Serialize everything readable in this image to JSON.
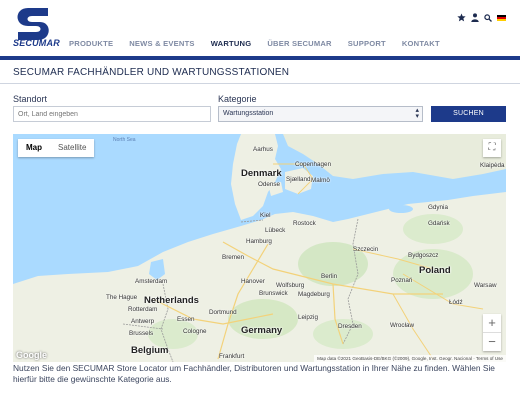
{
  "header": {
    "logo_text": "SECUMAR",
    "nav": [
      "PRODUKTE",
      "NEWS & EVENTS",
      "WARTUNG",
      "ÜBER SECUMAR",
      "SUPPORT",
      "KONTAKT"
    ],
    "active_nav": "WARTUNG",
    "utility_icons": [
      "star-icon",
      "user-icon",
      "search-icon",
      "german-flag-icon"
    ]
  },
  "page": {
    "title": "SECUMAR FACHHÄNDLER UND WARTUNGSSTATIONEN"
  },
  "form": {
    "standort_label": "Standort",
    "standort_placeholder": "Ort, Land eingeben",
    "kategorie_label": "Kategorie",
    "kategorie_value": "Wartungsstation",
    "search_button": "SUCHEN"
  },
  "map": {
    "type_map": "Map",
    "type_satellite": "Satellite",
    "zoom_in": "+",
    "zoom_out": "−",
    "google": "Google",
    "attribution": "Map data ©2021 GeoBasis-DE/BKG (©2009), Google, Inst. Geogr. Nacional · Terms of Use",
    "labels": {
      "north_sea": "North Sea",
      "aarhus": "Aarhus",
      "denmark": "Denmark",
      "odense": "Odense",
      "copenhagen": "Copenhagen",
      "malmo": "Malmö",
      "sjaelland": "Sjælland",
      "klaipeda": "Klaipėda",
      "kiel": "Kiel",
      "lubeck": "Lübeck",
      "rostock": "Rostock",
      "gdynia": "Gdynia",
      "gdansk": "Gdańsk",
      "hamburg": "Hamburg",
      "szczecin": "Szczecin",
      "bremen": "Bremen",
      "bydgoszcz": "Bydgoszcz",
      "poland": "Poland",
      "amsterdam": "Amsterdam",
      "berlin": "Berlin",
      "the_hague": "The Hague",
      "netherlands": "Netherlands",
      "hanover": "Hanover",
      "wolfsburg": "Wolfsburg",
      "brunswick": "Brunswick",
      "magdeburg": "Magdeburg",
      "poznan": "Poznań",
      "warsaw": "Warsaw",
      "rotterdam": "Rotterdam",
      "antwerp": "Antwerp",
      "essen": "Essen",
      "dortmund": "Dortmund",
      "leipzig": "Leipzig",
      "lodz": "Łódź",
      "brussels": "Brussels",
      "cologne": "Cologne",
      "germany": "Germany",
      "dresden": "Dresden",
      "wroclaw": "Wrocław",
      "belgium": "Belgium",
      "frankfurt": "Frankfurt"
    }
  },
  "description": "Nutzen Sie den SECUMAR Store Locator um Fachhändler, Distributoren und Wartungsstation in Ihrer Nähe zu finden. Wählen Sie hierfür bitte die gewünschte Kategorie aus.",
  "colors": {
    "brand": "#1d3a8a",
    "water": "#aadaff",
    "land": "#eef0e4"
  }
}
